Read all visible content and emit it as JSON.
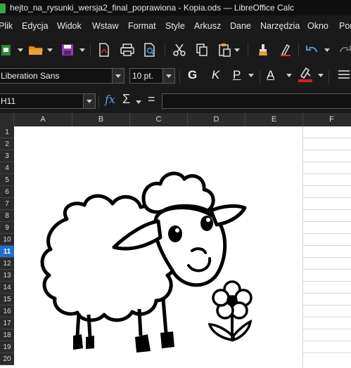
{
  "window": {
    "title": "hejto_na_rysunki_wersja2_final_poprawiona - Kopia.ods — LibreOffice Calc"
  },
  "menu": {
    "items": [
      "Plik",
      "Edycja",
      "Widok",
      "Wstaw",
      "Format",
      "Style",
      "Arkusz",
      "Dane",
      "Narzędzia",
      "Okno",
      "Pom"
    ]
  },
  "toolbar": {
    "icons": [
      "new-document-icon",
      "open-folder-icon",
      "save-icon",
      "export-pdf-icon",
      "print-icon",
      "print-preview-icon",
      "cut-icon",
      "copy-icon",
      "paste-icon",
      "clone-formatting-icon",
      "clear-formatting-icon",
      "undo-icon",
      "redo-icon"
    ]
  },
  "format": {
    "font_name": "Liberation Sans",
    "font_size": "10 pt.",
    "bold_label": "G",
    "italic_label": "K",
    "underline_label": "P",
    "font_color_label": "A",
    "font_color": "#ffffff",
    "highlight_color": "#e01b24"
  },
  "formula": {
    "name_box": "H11",
    "function_wizard": "fx",
    "sum_label": "Σ",
    "equals_label": "=",
    "content": ""
  },
  "columns": [
    "A",
    "B",
    "C",
    "D",
    "E",
    "F"
  ],
  "rows": [
    "1",
    "2",
    "3",
    "4",
    "5",
    "6",
    "7",
    "8",
    "9",
    "10",
    "11",
    "12",
    "13",
    "14",
    "15",
    "16",
    "17",
    "18",
    "19",
    "20"
  ],
  "active_row": "11",
  "drawing": {
    "subject": "sheep-with-flower",
    "line_color": "#000000",
    "fill_color": "#ffffff"
  }
}
